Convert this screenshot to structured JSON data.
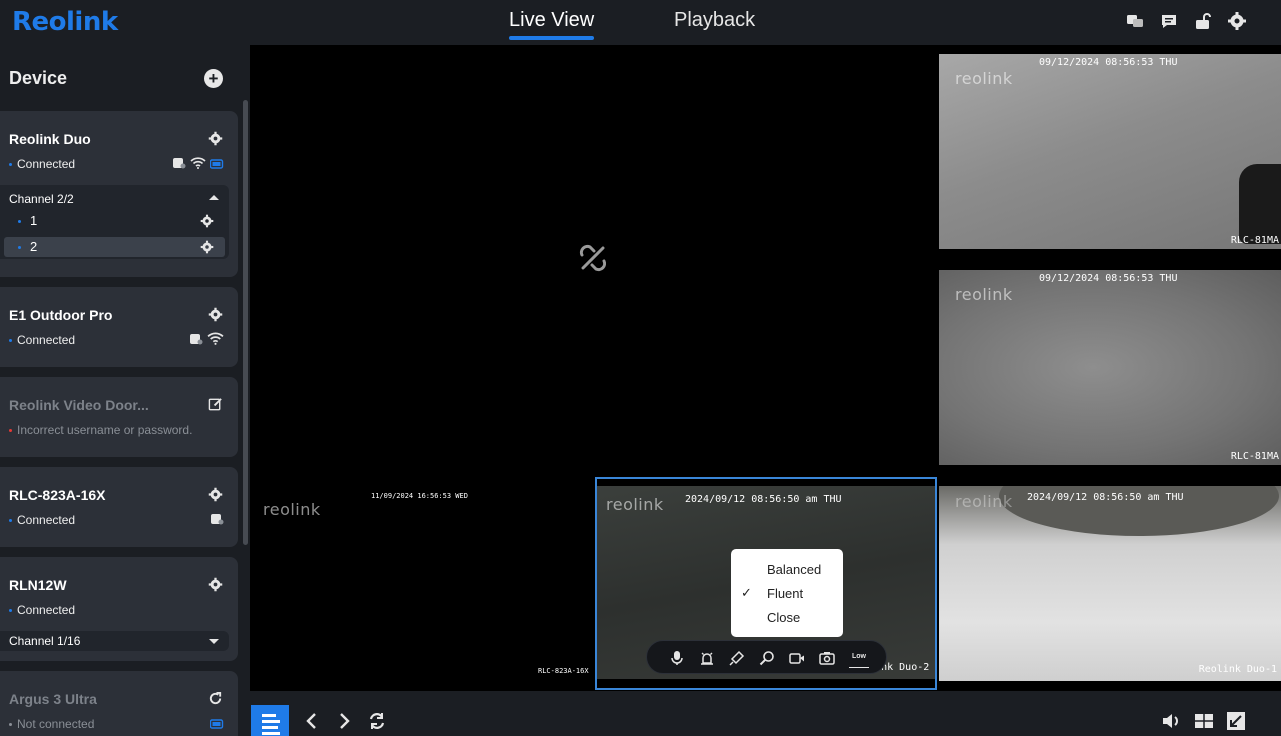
{
  "app": {
    "logo": "Reolink",
    "accent_color": "#1f7be8"
  },
  "header": {
    "tabs": [
      {
        "label": "Live View",
        "active": true
      },
      {
        "label": "Playback",
        "active": false
      }
    ],
    "icons": [
      "chat-translate-icon",
      "message-icon",
      "unlock-icon",
      "gear-icon"
    ]
  },
  "sidebar": {
    "title": "Device",
    "devices": [
      {
        "name": "Reolink Duo",
        "status": "Connected",
        "status_color": "#1f7be8",
        "channel_header": "Channel 2/2",
        "channels": [
          {
            "label": "1"
          },
          {
            "label": "2",
            "selected": true
          }
        ]
      },
      {
        "name": "E1 Outdoor Pro",
        "status": "Connected",
        "status_color": "#1f7be8"
      },
      {
        "name": "Reolink Video Door...",
        "status": "Incorrect username or password.",
        "status_color": "#e53935"
      },
      {
        "name": "RLC-823A-16X",
        "status": "Connected",
        "status_color": "#1f7be8"
      },
      {
        "name": "RLN12W",
        "status": "Connected",
        "status_color": "#1f7be8",
        "channel_header": "Channel 1/16"
      },
      {
        "name": "Argus 3 Ultra",
        "status": "Not connected",
        "status_color": "#8a8f96"
      }
    ]
  },
  "feeds": [
    {
      "id": "main-disconnected",
      "icon": "disconnected-link-icon"
    },
    {
      "id": "rlc-81ma-1",
      "timestamp": "09/12/2024 08:56:53 THU",
      "name": "RLC-81MA",
      "watermark": "reolink"
    },
    {
      "id": "rlc-81ma-2",
      "timestamp": "09/12/2024 08:56:53 THU",
      "name": "RLC-81MA",
      "watermark": "reolink"
    },
    {
      "id": "rlc-823a",
      "timestamp": "11/09/2024 16:56:53 WED",
      "name": "RLC-823A-16X",
      "watermark": "reolink"
    },
    {
      "id": "duo-2",
      "timestamp": "2024/09/12 08:56:50 am THU",
      "name": "Reolink Duo-2",
      "watermark": "reolink"
    },
    {
      "id": "duo-1",
      "timestamp": "2024/09/12 08:56:50 am THU",
      "name": "Reolink Duo-1",
      "watermark": "reolink"
    }
  ],
  "quality_menu": {
    "options": [
      {
        "label": "Balanced",
        "checked": false
      },
      {
        "label": "Fluent",
        "checked": true
      },
      {
        "label": "Close",
        "checked": false
      }
    ]
  },
  "controls": {
    "quality_badge": "Low"
  },
  "bottom": {
    "icons": [
      "layout-list-icon",
      "prev-icon",
      "next-icon",
      "refresh-icon",
      "volume-icon",
      "grid-icon",
      "fullscreen-icon"
    ]
  }
}
